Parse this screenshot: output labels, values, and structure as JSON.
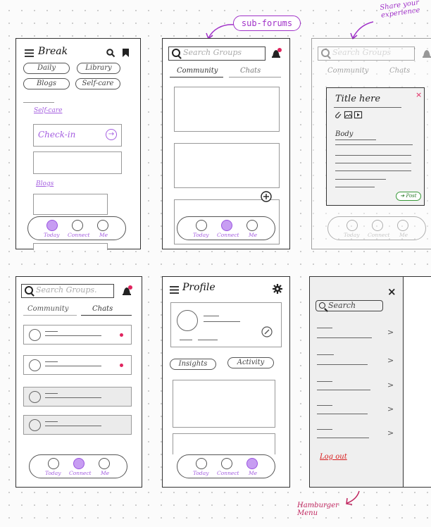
{
  "annotations": {
    "subforums": "sub-forums",
    "share": "Share your experience",
    "hamburger": "Hamburger Menu"
  },
  "home": {
    "app_title": "Break",
    "tags": [
      "Daily",
      "Library",
      "Blogs",
      "Self-care"
    ],
    "selfcare_heading": "Self-care",
    "checkin_label": "Check-in",
    "blogs_heading": "Blogs"
  },
  "nav": {
    "today": "Today",
    "connect": "Connect",
    "me": "Me"
  },
  "search": {
    "placeholder": "Search Groups",
    "placeholder_dot": "Search Groups."
  },
  "tabs": {
    "community": "Community",
    "chats": "Chats"
  },
  "post": {
    "title": "Title here",
    "body": "Body",
    "submit": "Post",
    "close": "×"
  },
  "profile": {
    "title": "Profile",
    "insights": "Insights",
    "activity": "Activity"
  },
  "menu": {
    "search": "Search",
    "close": "×",
    "logout": "Log out"
  },
  "colors": {
    "accent": "#c79df2",
    "accent_text": "#a45ee0",
    "annotation": "#a032c8",
    "unread_dot": "#e0245e",
    "logout": "#d81b1b"
  }
}
